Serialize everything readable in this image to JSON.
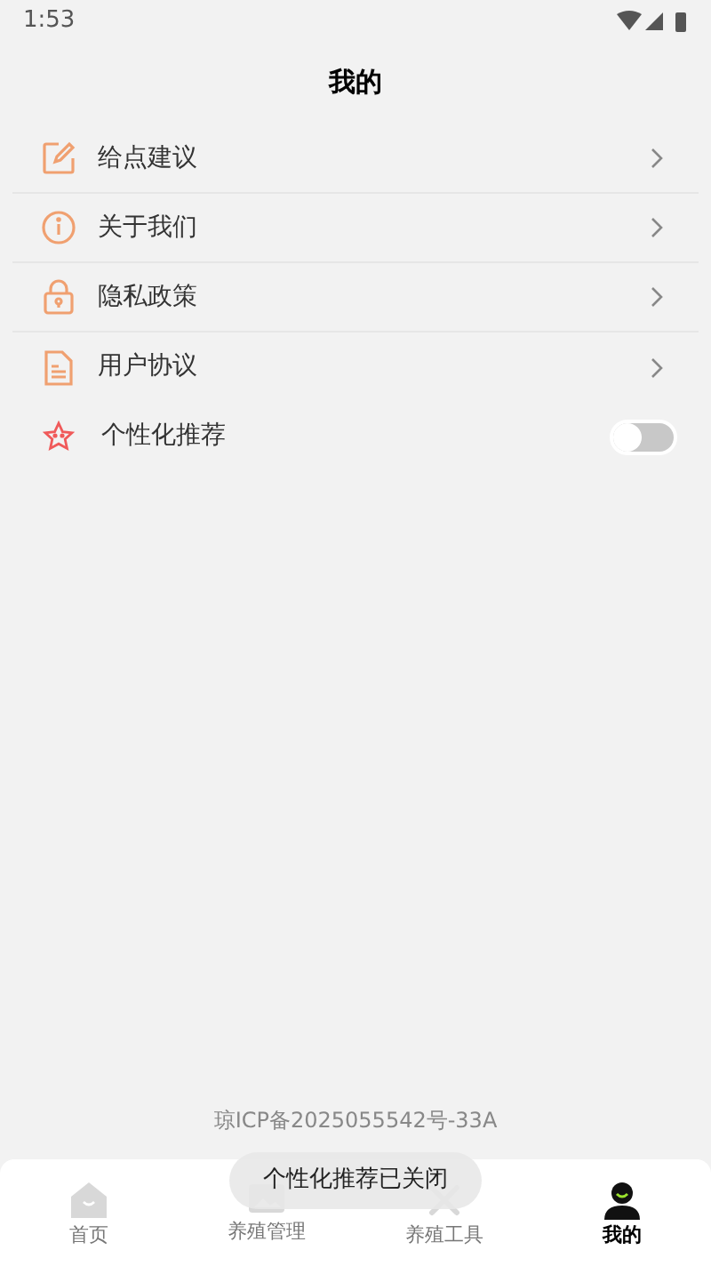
{
  "status_bar": {
    "time": "1:53"
  },
  "title": "我的",
  "menu": [
    {
      "kind": "link",
      "label": "给点建议"
    },
    {
      "kind": "link",
      "label": "关于我们"
    },
    {
      "kind": "link",
      "label": "隐私政策"
    },
    {
      "kind": "link",
      "label": "用户协议"
    },
    {
      "kind": "switch",
      "label": "个性化推荐",
      "on": false
    }
  ],
  "footer": "琼ICP备2025055542号-33A",
  "tabs": [
    {
      "label": "首页",
      "selected": false
    },
    {
      "label": "养殖管理",
      "selected": false
    },
    {
      "label": "养殖工具",
      "selected": false
    },
    {
      "label": "我的",
      "selected": true
    }
  ],
  "toast": "个性化推荐已关闭"
}
